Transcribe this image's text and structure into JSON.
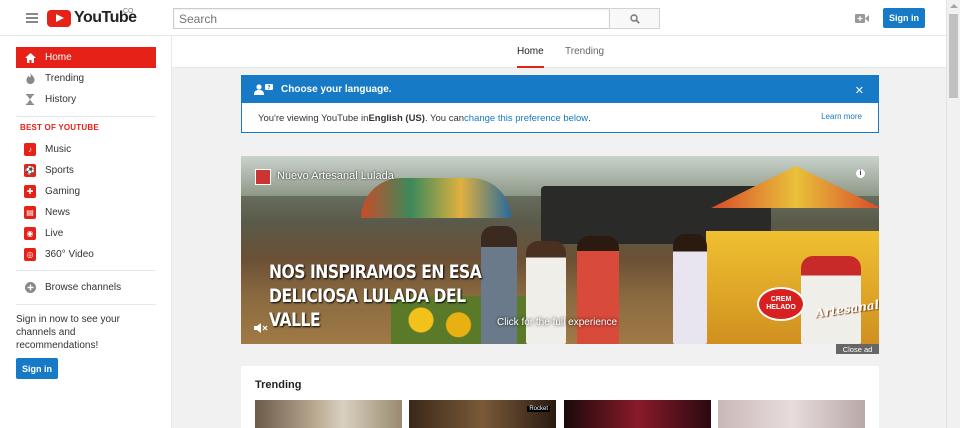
{
  "header": {
    "logo_text": "YouTube",
    "country_code": "CO",
    "search_placeholder": "Search",
    "sign_in_label": "Sign in",
    "icons": [
      "menu-icon",
      "search-icon",
      "upload-icon"
    ]
  },
  "guide": {
    "items": [
      {
        "label": "Home",
        "icon": "home-icon"
      },
      {
        "label": "Trending",
        "icon": "flame-icon"
      },
      {
        "label": "History",
        "icon": "hourglass-icon"
      }
    ],
    "best_heading": "BEST OF YOUTUBE",
    "channels": [
      {
        "label": "Music",
        "icon": "music-icon"
      },
      {
        "label": "Sports",
        "icon": "sports-icon"
      },
      {
        "label": "Gaming",
        "icon": "gaming-icon"
      },
      {
        "label": "News",
        "icon": "news-icon"
      },
      {
        "label": "Live",
        "icon": "live-icon"
      },
      {
        "label": "360° Video",
        "icon": "360-video-icon"
      }
    ],
    "browse_channels": "Browse channels",
    "signin_prompt": "Sign in now to see your channels and recommendations!",
    "signin_button": "Sign in"
  },
  "tabs": {
    "home": "Home",
    "trending": "Trending"
  },
  "language_banner": {
    "title": "Choose your language.",
    "text_before": "You're viewing YouTube in ",
    "language": "English (US)",
    "text_mid": ". You can ",
    "link": "change this preference below",
    "text_after": ".",
    "learn_more": "Learn more"
  },
  "ad": {
    "channel_title": "Nuevo Artesanal Lulada",
    "headline_line1": "NOS INSPIRAMOS EN ESA",
    "headline_line2": "DELICIOSA LULADA DEL VALLE",
    "cta": "Click for the full experience",
    "brand": "CREM HELADO",
    "brand_sub": "Artesanal",
    "close_label": "Close ad"
  },
  "trending": {
    "title": "Trending",
    "thumb_label": "Rocket"
  },
  "colors": {
    "brand_red": "#e62117",
    "accent_blue": "#167ac6"
  }
}
